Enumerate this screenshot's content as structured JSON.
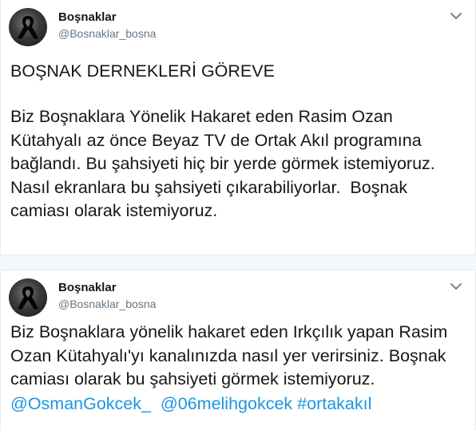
{
  "tweets": [
    {
      "author": {
        "name": "Boşnaklar",
        "handle": "@Bosnaklar_bosna"
      },
      "headline": "BOŞNAK DERNEKLERİ GÖREVE",
      "body": "Biz Boşnaklara Yönelik Hakaret eden Rasim Ozan\nKütahyalı az önce Beyaz TV de Ortak Akıl programına\nbağlandı. Bu şahsiyeti hiç bir yerde görmek istemiyoruz.\nNasıl ekranlara bu şahsiyeti çıkarabiliyorlar.  Boşnak\ncamiası olarak istemiyoruz."
    },
    {
      "author": {
        "name": "Boşnaklar",
        "handle": "@Bosnaklar_bosna"
      },
      "body": "Biz Boşnaklara yönelik hakaret eden Irkçılık yapan Rasim\nOzan Kütahyalı'yı kanalınızda nasıl yer verirsiniz. Boşnak\ncamiası olarak bu şahsiyeti görmek istemiyoruz.",
      "mentions": [
        "@OsmanGokcek_",
        "@06melihgokcek"
      ],
      "hashtag": "#ortakakıl"
    }
  ],
  "icons": {
    "avatar": "black-ribbon-avatar-icon",
    "menu": "chevron-down-icon"
  },
  "colors": {
    "link": "#1b95e0",
    "secondary_text": "#657786",
    "divider": "#e6ecf0"
  }
}
